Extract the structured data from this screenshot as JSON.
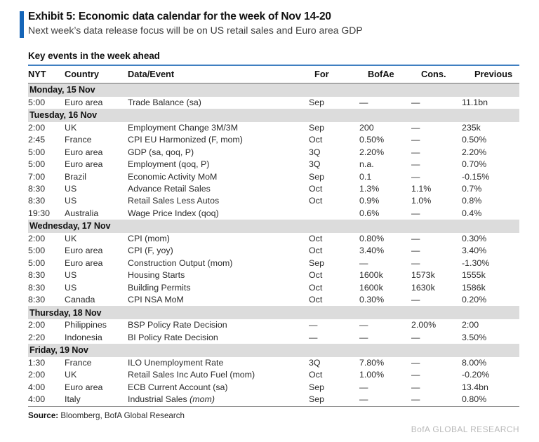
{
  "exhibit": {
    "title": "Exhibit 5: Economic data calendar for the week of Nov 14-20",
    "subtitle": "Next week’s data release focus will be on US retail sales and Euro area GDP",
    "accent_color": "#1565b8"
  },
  "table": {
    "caption": "Key events in the week ahead",
    "columns": [
      {
        "key": "nyt",
        "label": "NYT"
      },
      {
        "key": "country",
        "label": "Country"
      },
      {
        "key": "event",
        "label": "Data/Event"
      },
      {
        "key": "for",
        "label": "For"
      },
      {
        "key": "bofae",
        "label": "BofAe"
      },
      {
        "key": "cons",
        "label": "Cons."
      },
      {
        "key": "prev",
        "label": "Previous"
      }
    ],
    "sections": [
      {
        "day": "Monday, 15 Nov",
        "rows": [
          {
            "nyt": "5:00",
            "country": "Euro area",
            "event": "Trade Balance (sa)",
            "for": "Sep",
            "bofae": "—",
            "cons": "—",
            "prev": "11.1bn"
          }
        ]
      },
      {
        "day": "Tuesday, 16 Nov",
        "rows": [
          {
            "nyt": "2:00",
            "country": "UK",
            "event": "Employment Change 3M/3M",
            "for": "Sep",
            "bofae": "200",
            "cons": "—",
            "prev": "235k"
          },
          {
            "nyt": "2:45",
            "country": "France",
            "event": "CPI EU Harmonized (F, mom)",
            "for": "Oct",
            "bofae": "0.50%",
            "cons": "—",
            "prev": "0.50%"
          },
          {
            "nyt": "5:00",
            "country": "Euro area",
            "event": "GDP (sa, qoq, P)",
            "for": "3Q",
            "bofae": "2.20%",
            "cons": "—",
            "prev": "2.20%"
          },
          {
            "nyt": "5:00",
            "country": "Euro area",
            "event": "Employment (qoq, P)",
            "for": "3Q",
            "bofae": "n.a.",
            "cons": "—",
            "prev": "0.70%"
          },
          {
            "nyt": "7:00",
            "country": "Brazil",
            "event": "Economic Activity MoM",
            "for": "Sep",
            "bofae": "0.1",
            "cons": "—",
            "prev": "-0.15%"
          },
          {
            "nyt": "8:30",
            "country": "US",
            "event": "Advance Retail Sales",
            "for": "Oct",
            "bofae": "1.3%",
            "cons": "1.1%",
            "prev": "0.7%"
          },
          {
            "nyt": "8:30",
            "country": "US",
            "event": "Retail Sales Less Autos",
            "for": "Oct",
            "bofae": "0.9%",
            "cons": "1.0%",
            "prev": "0.8%"
          },
          {
            "nyt": "19:30",
            "country": "Australia",
            "event": "Wage Price Index (qoq)",
            "for": "",
            "bofae": "0.6%",
            "cons": "—",
            "prev": "0.4%"
          }
        ]
      },
      {
        "day": "Wednesday, 17 Nov",
        "rows": [
          {
            "nyt": "2:00",
            "country": "UK",
            "event": "CPI (mom)",
            "for": "Oct",
            "bofae": "0.80%",
            "cons": "—",
            "prev": "0.30%"
          },
          {
            "nyt": "5:00",
            "country": "Euro area",
            "event": "CPI (F, yoy)",
            "for": "Oct",
            "bofae": "3.40%",
            "cons": "—",
            "prev": "3.40%"
          },
          {
            "nyt": "5:00",
            "country": "Euro area",
            "event": "Construction Output (mom)",
            "for": "Sep",
            "bofae": "—",
            "cons": "—",
            "prev": "-1.30%"
          },
          {
            "nyt": "8:30",
            "country": "US",
            "event": "Housing Starts",
            "for": "Oct",
            "bofae": "1600k",
            "cons": "1573k",
            "prev": "1555k"
          },
          {
            "nyt": "8:30",
            "country": "US",
            "event": "Building Permits",
            "for": "Oct",
            "bofae": "1600k",
            "cons": "1630k",
            "prev": "1586k"
          },
          {
            "nyt": "8:30",
            "country": "Canada",
            "event": "CPI NSA MoM",
            "for": "Oct",
            "bofae": "0.30%",
            "cons": "—",
            "prev": "0.20%"
          }
        ]
      },
      {
        "day": "Thursday, 18 Nov",
        "rows": [
          {
            "nyt": "2:00",
            "country": "Philippines",
            "event": "BSP Policy Rate Decision",
            "for": "—",
            "bofae": "—",
            "cons": "2.00%",
            "prev": "2:00"
          },
          {
            "nyt": "2:20",
            "country": "Indonesia",
            "event": "BI Policy Rate Decision",
            "for": "—",
            "bofae": "—",
            "cons": "—",
            "prev": "3.50%"
          }
        ]
      },
      {
        "day": "Friday, 19 Nov",
        "rows": [
          {
            "nyt": "1:30",
            "country": "France",
            "event": "ILO Unemployment Rate",
            "for": "3Q",
            "bofae": "7.80%",
            "cons": "—",
            "prev": "8.00%"
          },
          {
            "nyt": "2:00",
            "country": "UK",
            "event": "Retail Sales Inc Auto Fuel (mom)",
            "for": "Oct",
            "bofae": "1.00%",
            "cons": "—",
            "prev": "-0.20%"
          },
          {
            "nyt": "4:00",
            "country": "Euro area",
            "event": "ECB Current Account (sa)",
            "for": "Sep",
            "bofae": "—",
            "cons": "—",
            "prev": "13.4bn"
          },
          {
            "nyt": "4:00",
            "country": "Italy",
            "event_plain": "Industrial Sales ",
            "event_italic": "(mom)",
            "for": "Sep",
            "bofae": "—",
            "cons": "—",
            "prev": "0.80%"
          }
        ]
      }
    ]
  },
  "footer": {
    "source_label": "Source:",
    "source_text": "Bloomberg, BofA Global Research",
    "brandmark": "BofA GLOBAL RESEARCH"
  }
}
